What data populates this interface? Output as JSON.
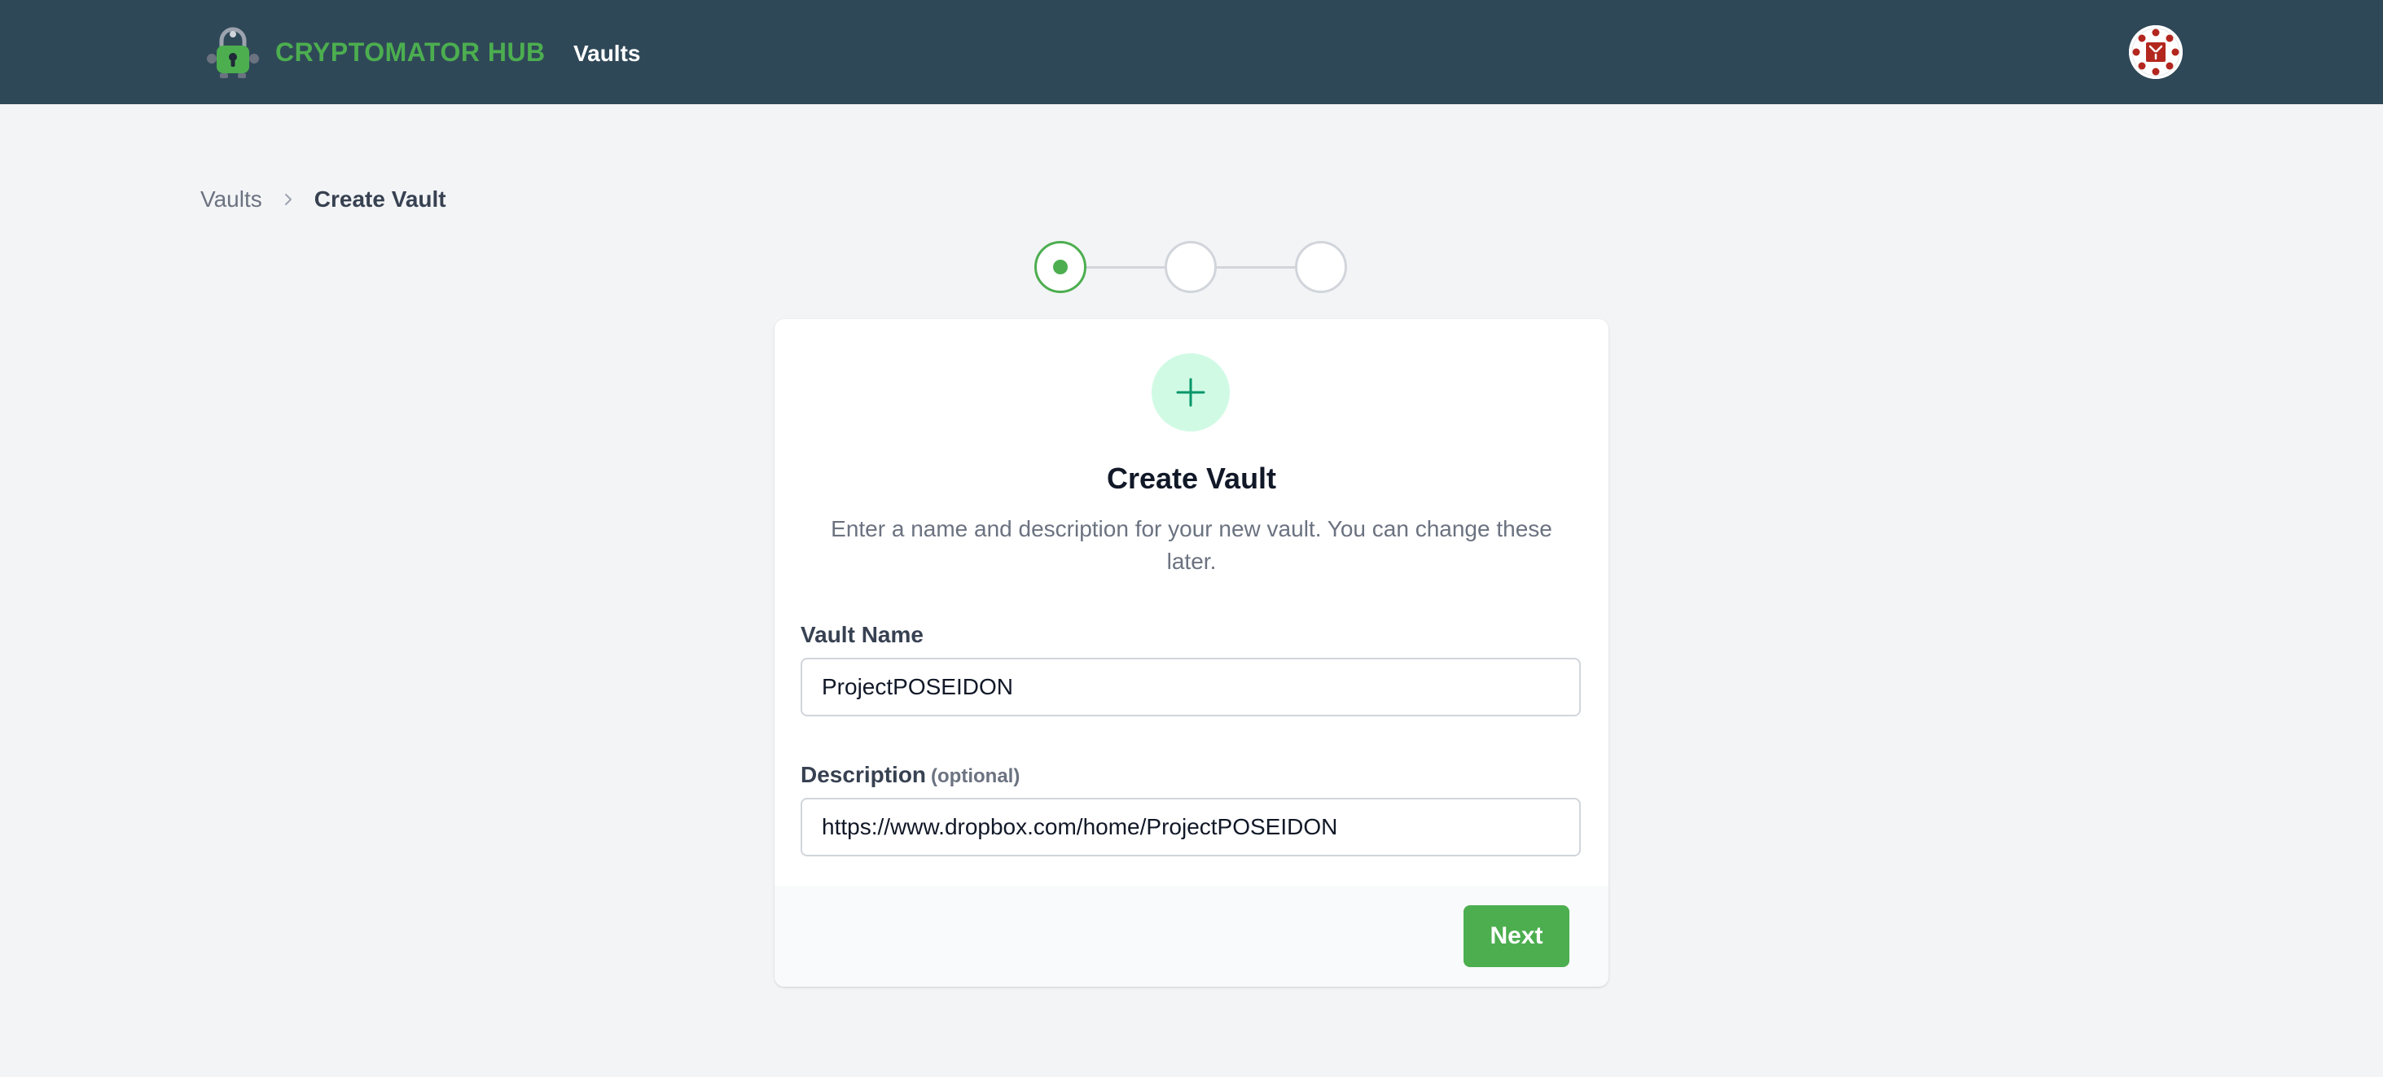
{
  "header": {
    "brand": "CRYPTOMATOR HUB",
    "nav_vaults": "Vaults",
    "logo_icon": "cryptomator-robot-lock-icon",
    "avatar_icon": "user-avatar-icon"
  },
  "breadcrumb": {
    "root": "Vaults",
    "current": "Create Vault",
    "separator_icon": "chevron-right-icon"
  },
  "stepper": {
    "total_steps": 3,
    "current_step": 1
  },
  "card": {
    "icon": "plus-icon",
    "title": "Create Vault",
    "description": "Enter a name and description for your new vault. You can change these later.",
    "vault_name": {
      "label": "Vault Name",
      "value": "ProjectPOSEIDON"
    },
    "description_field": {
      "label": "Description",
      "optional": "(optional)",
      "value": "https://www.dropbox.com/home/ProjectPOSEIDON"
    },
    "next_label": "Next"
  },
  "colors": {
    "nav_bg": "#2f4858",
    "brand_green": "#4cae4f",
    "page_bg": "#f3f4f6",
    "icon_circle_bg": "#d1fae5",
    "icon_green": "#059669",
    "avatar_red": "#b3261e"
  }
}
